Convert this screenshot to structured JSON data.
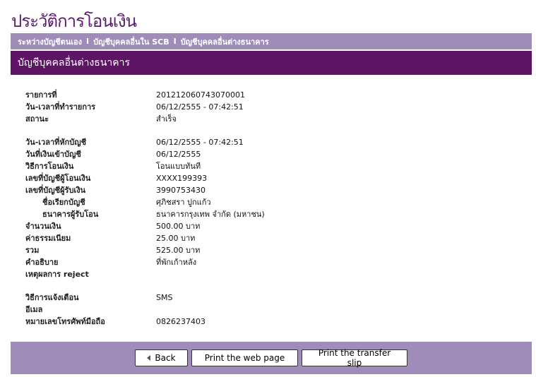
{
  "page": {
    "title": "ประวัติการโอนเงิน"
  },
  "tabs": [
    {
      "label": "ระหว่างบัญชีตนเอง"
    },
    {
      "label": "บัญชีบุคคลอื่นใน SCB"
    },
    {
      "label": "บัญชีบุคคลอื่นต่างธนาคาร"
    }
  ],
  "tab_separator": "I",
  "section": {
    "title": "บัญชีบุคคลอื่นต่างธนาคาร"
  },
  "details": [
    {
      "label": "รายการที่",
      "value": "201212060743070001"
    },
    {
      "label": "วัน-เวลาที่ทำรายการ",
      "value": "06/12/2555 - 07:42:51"
    },
    {
      "label": "สถานะ",
      "value": "สำเร็จ"
    },
    {
      "label": "วัน-เวลาที่หักบัญชี",
      "value": "06/12/2555 - 07:42:51"
    },
    {
      "label": "วันที่เงินเข้าบัญชี",
      "value": "06/12/2555"
    },
    {
      "label": "วิธีการโอนเงิน",
      "value": "โอนแบบทันที"
    },
    {
      "label": "เลขที่บัญชีผู้โอนเงิน",
      "value": "XXXX199393"
    },
    {
      "label": "เลขที่บัญชีผู้รับเงิน",
      "value": "3990753430"
    },
    {
      "label": "ชื่อเรียกบัญชี",
      "value": "ศุภิชสรา ปูกแก้ว"
    },
    {
      "label": "ธนาคารผู้รับโอน",
      "value": "ธนาคารกรุงเทพ จำกัด (มหาชน)"
    },
    {
      "label": "จำนวนเงิน",
      "value": "500.00 บาท"
    },
    {
      "label": "ค่าธรรมเนียม",
      "value": "25.00 บาท"
    },
    {
      "label": "รวม",
      "value": "525.00 บาท"
    },
    {
      "label": "คำอธิบาย",
      "value": "ที่พักเก้าหลัง"
    },
    {
      "label": "เหตุผลการ reject",
      "value": ""
    },
    {
      "label": "วิธีการแจ้งเตือน",
      "value": "SMS"
    },
    {
      "label": "อีเมล",
      "value": ""
    },
    {
      "label": "หมายเลขโทรศัพท์มือถือ",
      "value": "0826237403"
    }
  ],
  "buttons": {
    "back": "Back",
    "print_page": "Print the web page",
    "print_slip": "Print the transfer slip"
  },
  "colors": {
    "brand": "#5d1465",
    "tabbar": "#9f8cb8"
  }
}
